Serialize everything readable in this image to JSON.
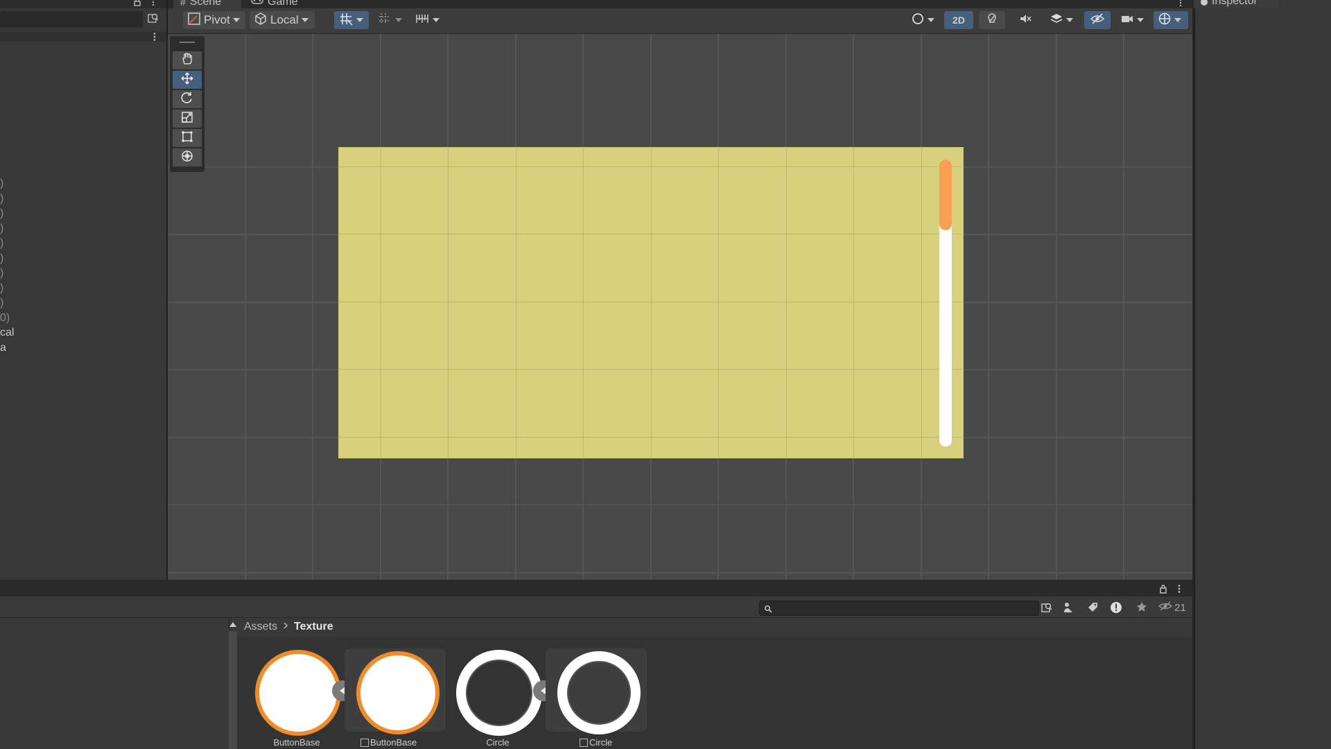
{
  "scene_tabs": [
    {
      "label": "Scene",
      "icon": "hash-icon"
    },
    {
      "label": "Game",
      "icon": "gamepad-icon"
    }
  ],
  "inspector_tab": {
    "label": "Inspector",
    "icon": "info-icon"
  },
  "toolbar": {
    "pivot_label": "Pivot",
    "local_label": "Local",
    "mode_2d_label": "2D"
  },
  "hierarchy_fragments": [
    ")",
    ")",
    ")",
    ")",
    ")",
    ")",
    ")",
    ")",
    ")",
    "0)",
    "cal",
    "a"
  ],
  "project": {
    "visible_count": "21",
    "breadcrumb": [
      "Assets",
      "Texture"
    ],
    "assets": [
      {
        "label": "ButtonBase",
        "style": "orange-ring"
      },
      {
        "label": "ButtonBase",
        "style": "orange-ring-sprite"
      },
      {
        "label": "Circle",
        "style": "white-ring"
      },
      {
        "label": "Circle",
        "style": "white-ring-sprite"
      }
    ]
  },
  "colors": {
    "panel_yellow": "#d7d07d",
    "scroll_handle_orange": "#f7a054",
    "accent_blue": "#46607c",
    "button_orange_ring": "#f08c2a"
  }
}
